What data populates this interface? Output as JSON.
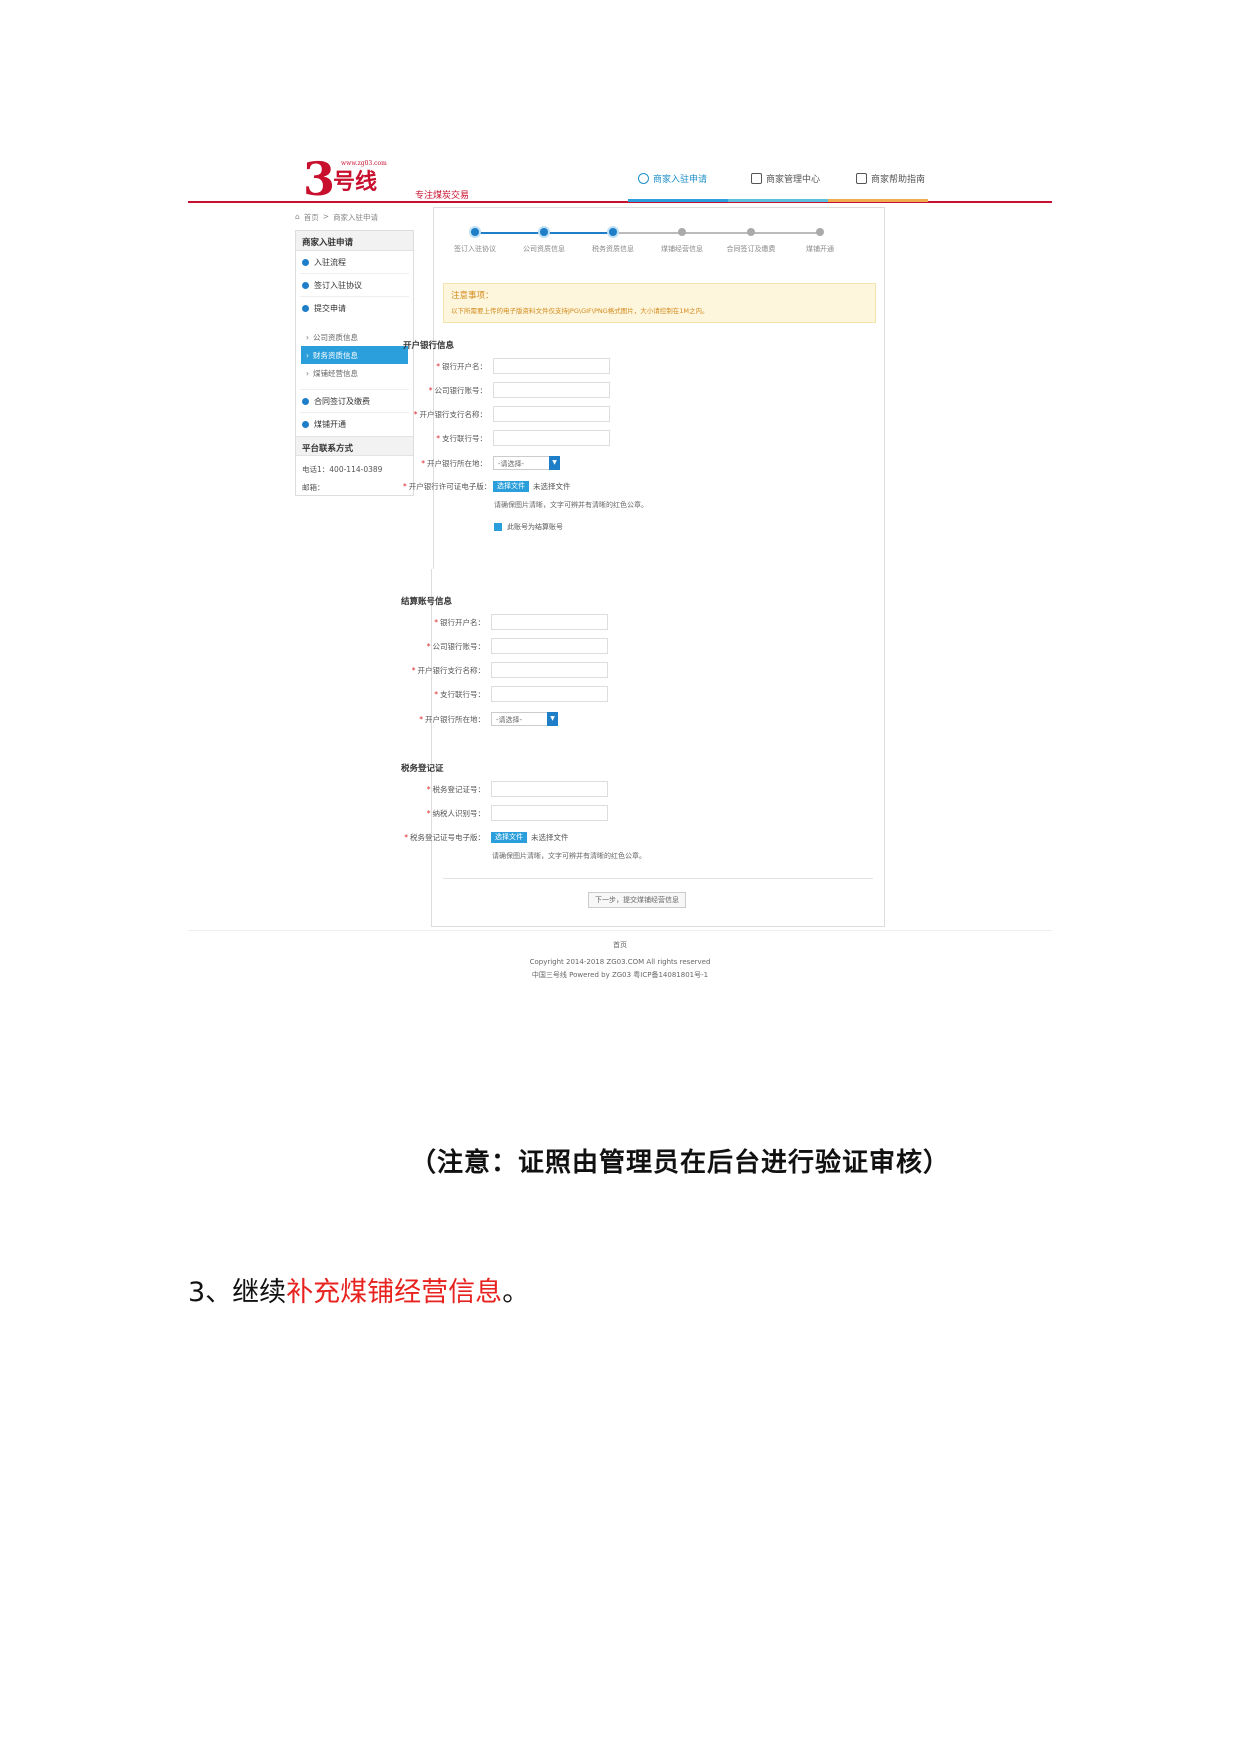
{
  "header": {
    "logo_number": "3",
    "logo_brand": "号线",
    "logo_site": "www.zg03.com",
    "logo_slogan": "专注煤炭交易",
    "nav": [
      {
        "label": "商家入驻申请",
        "icon": "pencil-icon",
        "active": true,
        "bar_color": "#2a9fdc"
      },
      {
        "label": "商家管理中心",
        "icon": "monitor-icon",
        "active": false,
        "bar_color": "#5bc0de"
      },
      {
        "label": "商家帮助指南",
        "icon": "book-icon",
        "active": false,
        "bar_color": "#f0ad4e"
      }
    ]
  },
  "breadcrumb": [
    "首页",
    ">",
    "商家入驻申请"
  ],
  "sidebar": {
    "title": "商家入驻申请",
    "items": [
      {
        "label": "入驻流程"
      },
      {
        "label": "签订入驻协议"
      },
      {
        "label": "提交申请"
      }
    ],
    "sub_items": [
      {
        "label": "公司资质信息",
        "active": false
      },
      {
        "label": "财务资质信息",
        "active": true
      },
      {
        "label": "煤铺经营信息",
        "active": false
      }
    ],
    "items2": [
      {
        "label": "合同签订及缴费"
      },
      {
        "label": "煤铺开通"
      }
    ],
    "contact_title": "平台联系方式",
    "phone": "电话1：400-114-0389",
    "email": "邮箱："
  },
  "steps": [
    {
      "label": "签订入驻协议",
      "done": true
    },
    {
      "label": "公司资质信息",
      "done": true
    },
    {
      "label": "税务资质信息",
      "done": true
    },
    {
      "label": "煤铺经营信息",
      "done": false
    },
    {
      "label": "合同签订及缴费",
      "done": false
    },
    {
      "label": "煤铺开通",
      "done": false
    }
  ],
  "notice": {
    "title": "注意事项：",
    "body": "以下所需要上传的电子版资料文件仅支持JPG\\GIF\\PNG格式图片，大小请控制在1M之内。"
  },
  "bank_section": {
    "title": "开户银行信息",
    "fields": [
      "银行开户名：",
      "公司银行账号：",
      "开户银行支行名称：",
      "支行联行号："
    ],
    "region_label": "开户银行所在地：",
    "region_value": "-请选择-",
    "license_label": "开户银行许可证电子版：",
    "file_button": "选择文件",
    "file_status": "未选择文件",
    "hint": "请确保图片清晰，文字可辨并有清晰的红色公章。",
    "checkbox_label": "此账号为结算账号"
  },
  "settle_section": {
    "title": "结算账号信息",
    "fields": [
      "银行开户名：",
      "公司银行账号：",
      "开户银行支行名称：",
      "支行联行号："
    ],
    "region_label": "开户银行所在地：",
    "region_value": "-请选择-"
  },
  "tax_section": {
    "title": "税务登记证",
    "fields": [
      "税务登记证号：",
      "纳税人识别号："
    ],
    "cert_label": "税务登记证号电子版：",
    "file_button": "选择文件",
    "file_status": "未选择文件",
    "hint": "请确保图片清晰，文字可辨并有清晰的红色公章。"
  },
  "next_button": "下一步，提交煤铺经营信息",
  "footer": {
    "link": "首页",
    "copyright": "Copyright 2014-2018 ZG03.COM All rights reserved",
    "icp": "中国三号线 Powered by ZG03 粤ICP备14081801号-1"
  },
  "doc": {
    "note": "（注意：证照由管理员在后台进行验证审核）",
    "para_prefix": "3、继续",
    "para_highlight": "补充煤铺经营信息",
    "para_suffix": "。"
  }
}
